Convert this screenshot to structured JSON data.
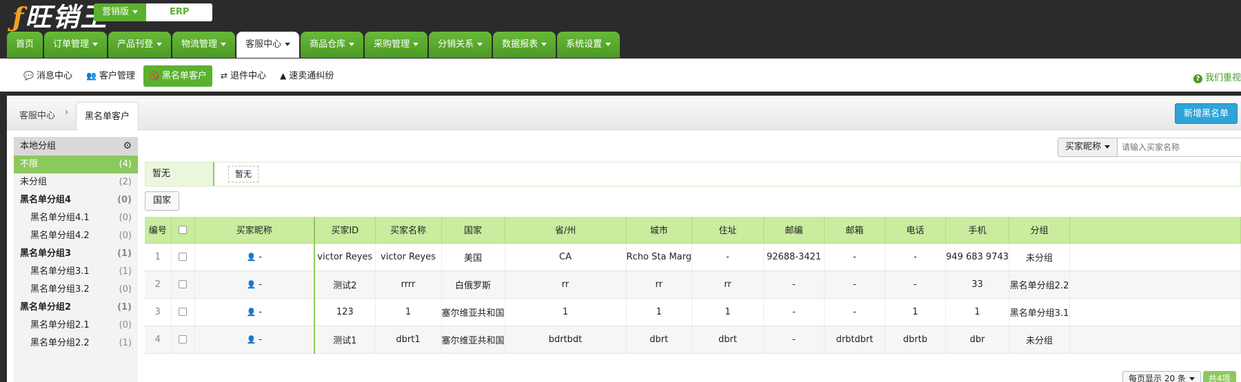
{
  "brand": {
    "logo_text": "旺销王",
    "edition": "营销版",
    "erp": "ERP"
  },
  "main_nav": [
    {
      "label": "首页",
      "caret": false
    },
    {
      "label": "订单管理",
      "caret": true
    },
    {
      "label": "产品刊登",
      "caret": true
    },
    {
      "label": "物流管理",
      "caret": true
    },
    {
      "label": "客服中心",
      "caret": true,
      "active": true
    },
    {
      "label": "商品仓库",
      "caret": true
    },
    {
      "label": "采购管理",
      "caret": true
    },
    {
      "label": "分销关系",
      "caret": true
    },
    {
      "label": "数据报表",
      "caret": true
    },
    {
      "label": "系统设置",
      "caret": true
    }
  ],
  "sub_nav": [
    {
      "label": "消息中心",
      "icon": "chat-icon"
    },
    {
      "label": "客户管理",
      "icon": "users-icon"
    },
    {
      "label": "黑名单客户",
      "icon": "blacklist-icon",
      "active": true
    },
    {
      "label": "退件中心",
      "icon": "return-icon"
    },
    {
      "label": "速卖通纠纷",
      "icon": "warning-icon"
    }
  ],
  "help_text": "我们重视",
  "breadcrumb": {
    "parent": "客服中心",
    "current": "黑名单客户"
  },
  "add_button": "新增黑名单",
  "sidebar": {
    "title": "本地分组",
    "items": [
      {
        "label": "不限",
        "count": "(4)",
        "type": "active"
      },
      {
        "label": "未分组",
        "count": "(2)",
        "type": "plain"
      },
      {
        "label": "黑名单分组4",
        "count": "(0)",
        "type": "group"
      },
      {
        "label": "黑名单分组4.1",
        "count": "(0)",
        "type": "child"
      },
      {
        "label": "黑名单分组4.2",
        "count": "(0)",
        "type": "child"
      },
      {
        "label": "黑名单分组3",
        "count": "(1)",
        "type": "group"
      },
      {
        "label": "黑名单分组3.1",
        "count": "(1)",
        "type": "child"
      },
      {
        "label": "黑名单分组3.2",
        "count": "(0)",
        "type": "child"
      },
      {
        "label": "黑名单分组2",
        "count": "(1)",
        "type": "group"
      },
      {
        "label": "黑名单分组2.1",
        "count": "(0)",
        "type": "child"
      },
      {
        "label": "黑名单分组2.2",
        "count": "(1)",
        "type": "child"
      }
    ]
  },
  "search": {
    "field": "买家昵称",
    "placeholder": "请输入买家名称"
  },
  "tag_filter": {
    "label": "暂无",
    "tag": "暂无"
  },
  "country_button": "国家",
  "table": {
    "columns": [
      "编号",
      "",
      "买家昵称",
      "买家ID",
      "买家名称",
      "国家",
      "省/州",
      "城市",
      "住址",
      "邮编",
      "邮箱",
      "电话",
      "手机",
      "分组"
    ],
    "rows": [
      [
        "1",
        "",
        "-",
        "victor Reyes",
        "victor Reyes",
        "美国",
        "CA",
        "Rcho Sta Marg",
        "-",
        "92688-3421",
        "-",
        "-",
        "949 683 9743",
        "未分组"
      ],
      [
        "2",
        "",
        "-",
        "测试2",
        "rrrr",
        "白俄罗斯",
        "rr",
        "rr",
        "rr",
        "-",
        "-",
        "-",
        "33",
        "黑名单分组2.2"
      ],
      [
        "3",
        "",
        "-",
        "123",
        "1",
        "塞尔维亚共和国",
        "1",
        "1",
        "1",
        "-",
        "-",
        "1",
        "1",
        "黑名单分组3.1"
      ],
      [
        "4",
        "",
        "-",
        "测试1",
        "dbrt1",
        "塞尔维亚共和国",
        "bdrtbdt",
        "dbrt",
        "dbrt",
        "-",
        "drbtdbrt",
        "dbrtb",
        "dbr",
        "未分组"
      ]
    ]
  },
  "pager": {
    "per_page": "每页显示 20 条",
    "total": "共4项"
  },
  "colors": {
    "green": "#5bb12f",
    "header_green": "#c9ec9f",
    "blue_button": "#2fa4d8"
  }
}
